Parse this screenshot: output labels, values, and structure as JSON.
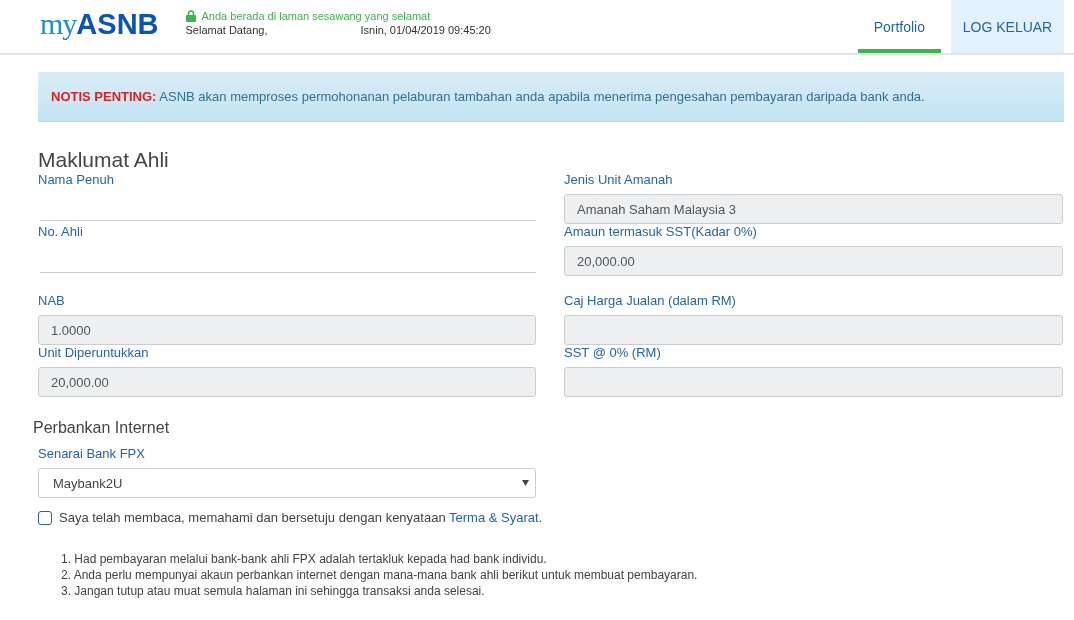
{
  "header": {
    "logo": {
      "prefix": "my",
      "main": "ASNB"
    },
    "secure_message": "Anda berada di laman sesawang yang selamat",
    "greeting": "Selamat Datang,",
    "datetime": "Isnin, 01/04/2019 09:45:20",
    "nav": [
      {
        "label": "Portfolio",
        "selected": true
      }
    ],
    "logout": "LOG KELUAR"
  },
  "notice": {
    "label": "NOTIS PENTING:",
    "text": "ASNB akan memproses permohonanan pelaburan tambahan anda apabila menerima pengesahan pembayaran daripada bank anda."
  },
  "member_info": {
    "title": "Maklumat Ahli",
    "left_fields": [
      {
        "label": "Nama Penuh",
        "kind": "line"
      },
      {
        "label": "No. Ahli",
        "kind": "line"
      },
      {
        "label": "NAB",
        "kind": "box",
        "value": "1.0000"
      },
      {
        "label": "Unit Diperuntukkan",
        "kind": "box",
        "value": "20,000.00"
      }
    ],
    "right_fields": [
      {
        "label": "Jenis Unit Amanah",
        "kind": "box",
        "value": "Amanah Saham Malaysia 3"
      },
      {
        "label": "Amaun termasuk SST(Kadar 0%)",
        "kind": "box",
        "value": "20,000.00"
      },
      {
        "label": "Caj Harga Jualan (dalam RM)",
        "kind": "box"
      },
      {
        "label": "SST @ 0% (RM)",
        "kind": "box"
      }
    ]
  },
  "internet_banking": {
    "title": "Perbankan Internet",
    "bank_label": "Senarai Bank FPX",
    "bank_value": "Maybank2U",
    "agreement": {
      "checked": false,
      "text": "Saya telah membaca, memahami dan bersetuju dengan kenyataan",
      "link": "Terma & Syarat."
    }
  },
  "notes": [
    "1. Had pembayaran melalui bank-bank ahli FPX adalah tertakluk kepada had bank individu.",
    "2. Anda perlu mempunyai akaun perbankan internet dengan mana-mana bank ahli berikut untuk membuat pembayaran.",
    "3. Jangan tutup atau muat semula halaman ini sehingga transaksi anda selesai."
  ]
}
